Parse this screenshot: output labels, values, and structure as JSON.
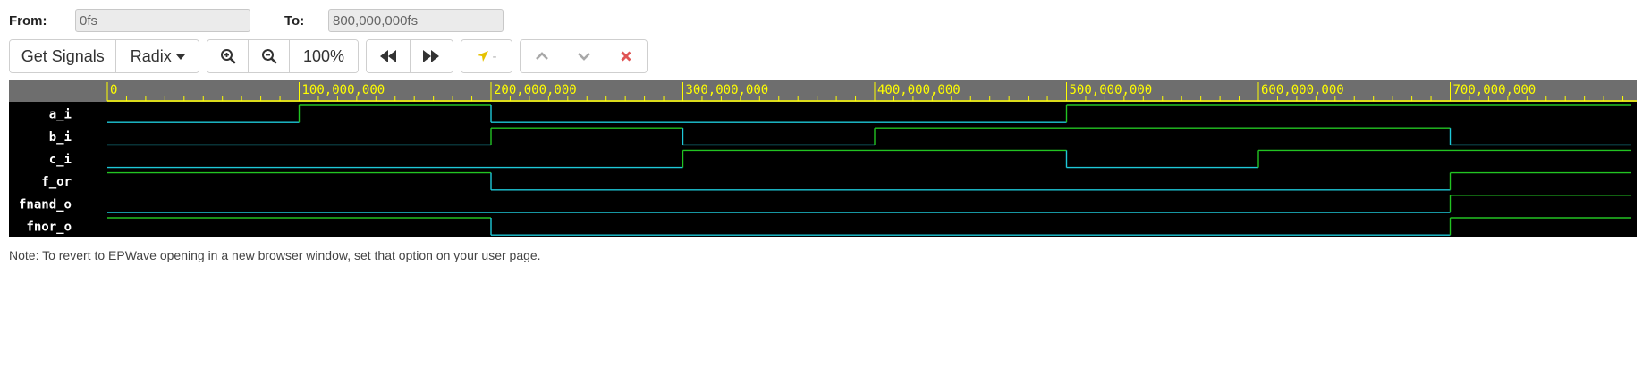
{
  "range": {
    "from_label": "From:",
    "from_value": "0fs",
    "to_label": "To:",
    "to_value": "800,000,000fs"
  },
  "toolbar": {
    "get_signals": "Get Signals",
    "radix": "Radix",
    "zoom_level": "100%",
    "marker_label": "-"
  },
  "timeline": {
    "start": 0,
    "end": 800000000,
    "tick_labels": [
      "0",
      "100,000,000",
      "200,000,000",
      "300,000,000",
      "400,000,000",
      "500,000,000",
      "600,000,000",
      "700,000,000"
    ]
  },
  "signals": [
    {
      "name": "a_i",
      "transitions": [
        [
          0,
          0
        ],
        [
          100000000,
          1
        ],
        [
          200000000,
          0
        ],
        [
          500000000,
          1
        ]
      ]
    },
    {
      "name": "b_i",
      "transitions": [
        [
          0,
          0
        ],
        [
          200000000,
          1
        ],
        [
          300000000,
          0
        ],
        [
          400000000,
          1
        ],
        [
          700000000,
          0
        ]
      ]
    },
    {
      "name": "c_i",
      "transitions": [
        [
          0,
          0
        ],
        [
          300000000,
          1
        ],
        [
          500000000,
          0
        ],
        [
          600000000,
          1
        ]
      ]
    },
    {
      "name": "f_or",
      "transitions": [
        [
          0,
          1
        ],
        [
          200000000,
          0
        ],
        [
          700000000,
          1
        ]
      ]
    },
    {
      "name": "fnand_o",
      "transitions": [
        [
          0,
          0
        ],
        [
          700000000,
          1
        ]
      ]
    },
    {
      "name": "fnor_o",
      "transitions": [
        [
          0,
          1
        ],
        [
          200000000,
          0
        ],
        [
          700000000,
          1
        ]
      ]
    }
  ],
  "colors": {
    "high": "#22c322",
    "low": "#1ec8d8",
    "ruler_bg": "#6e6e6e",
    "ruler_text": "#ffff00",
    "wave_bg": "#000000",
    "name_text": "#ffffff",
    "marker_icon": "#e6c200",
    "close_icon": "#e05555"
  },
  "icons": {
    "zoom_in": "zoom-in-icon",
    "zoom_out": "zoom-out-icon",
    "rewind": "rewind-icon",
    "fast_forward": "fast-forward-icon",
    "marker": "marker-arrow-icon",
    "up": "chevron-up-icon",
    "down": "chevron-down-icon",
    "close": "close-icon",
    "radix_caret": "caret-down-icon"
  },
  "note": "Note: To revert to EPWave opening in a new browser window, set that option on your user page."
}
